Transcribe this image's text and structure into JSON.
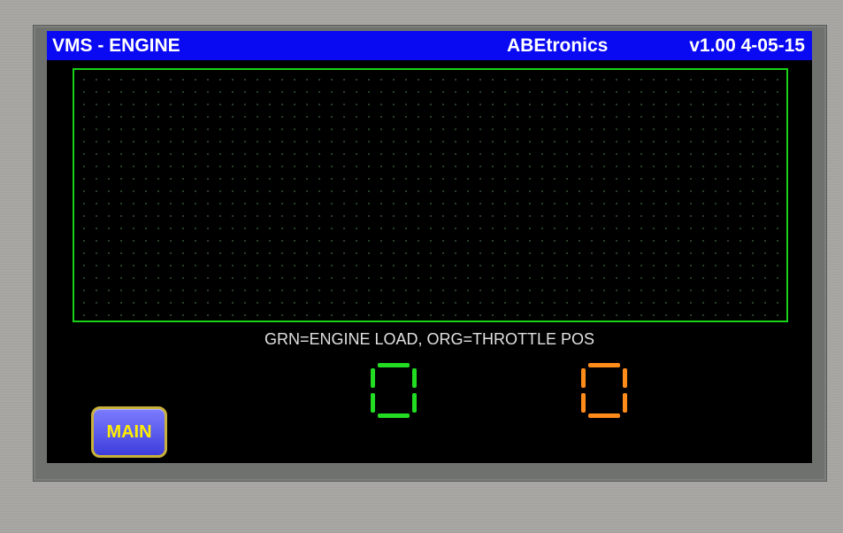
{
  "title_bar": {
    "app_title": "VMS - ENGINE",
    "brand": "ABEtronics",
    "version": "v1.00 4-05-15"
  },
  "legend": "GRN=ENGINE LOAD, ORG=THROTTLE POS",
  "readouts": {
    "engine_load": {
      "value": "0",
      "color": "#22dd22"
    },
    "throttle_pos": {
      "value": "0",
      "color": "#ff8c1a"
    }
  },
  "buttons": {
    "main_label": "MAIN"
  },
  "colors": {
    "title_bar_bg": "#0a0af2",
    "graph_border": "#17d217",
    "screen_bg": "#000000",
    "button_text": "#ffee00"
  }
}
